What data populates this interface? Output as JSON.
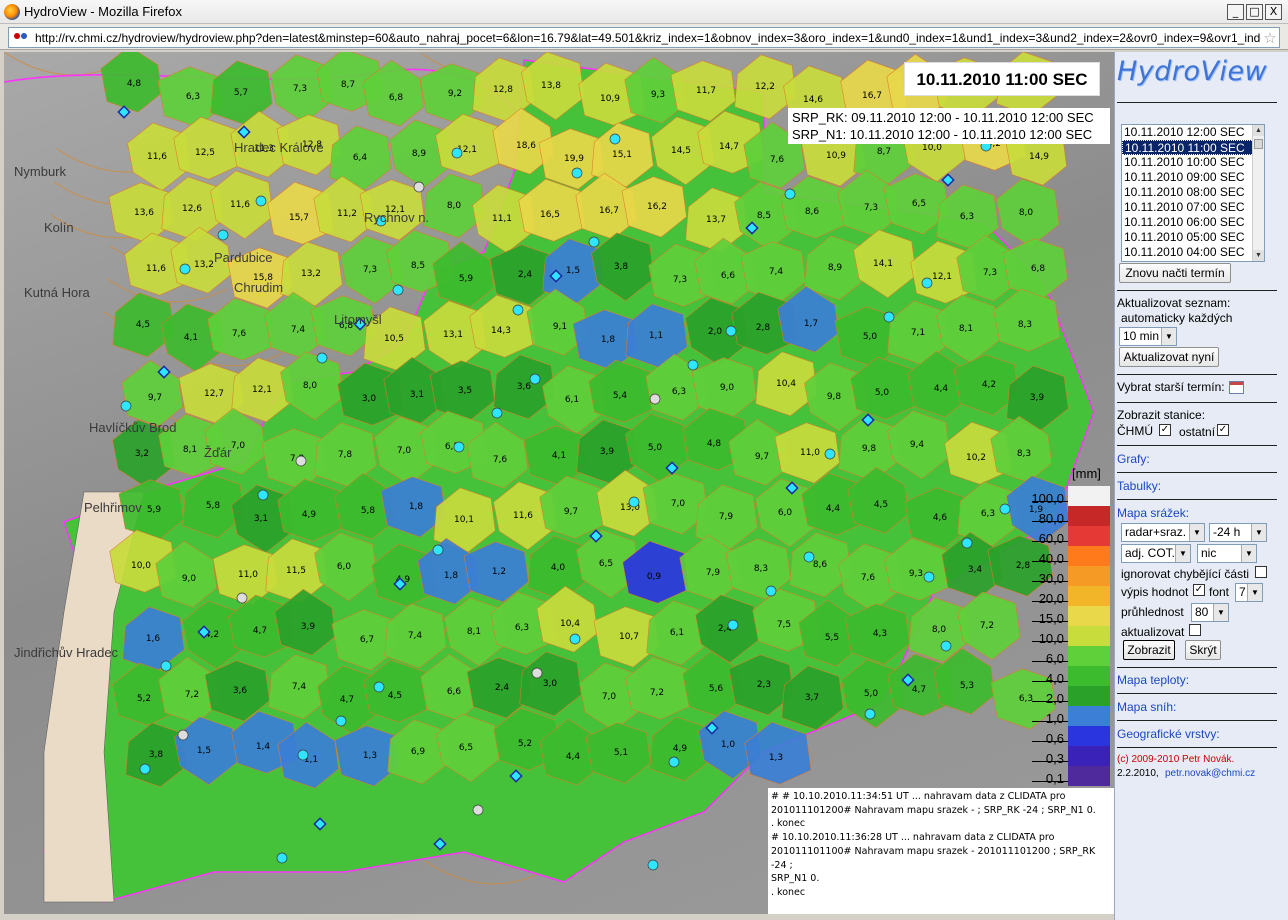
{
  "window": {
    "title": "HydroView - Mozilla Firefox",
    "minimize": "_",
    "maximize": "□",
    "close": "X"
  },
  "address_bar": {
    "url": "http://rv.chmi.cz/hydroview/hydroview.php?den=latest&minstep=60&auto_nahraj_pocet=6&lon=16.79&lat=49.501&kriz_index=1&obnov_index=3&oro_index=1&und0_index=1&und1_index=3&und2_index=2&ovr0_index=9&ovr1_index=12&ovr2_ir"
  },
  "map": {
    "date_label": "10.11.2010 11:00 SEC",
    "srp_lines": [
      "SRP_RK: 09.11.2010 12:00 - 10.11.2010 12:00 SEC",
      "SRP_N1: 10.11.2010 12:00 - 10.11.2010 12:00 SEC"
    ],
    "city_labels": [
      "Hradec Králové",
      "Nymburk",
      "Kolín",
      "Pardubice",
      "Chrudim",
      "Rychnov n.",
      "Kutná Hora",
      "Pelhřimov",
      "Jindřichův Hradec",
      "Litomyšl",
      "Havlíčkův Brod",
      "Žďár"
    ],
    "legend": {
      "unit": "[mm]",
      "levels": [
        {
          "label": "100,0",
          "color": "#f2f2f2"
        },
        {
          "label": "80,0",
          "color": "#c62828"
        },
        {
          "label": "60,0",
          "color": "#e53935"
        },
        {
          "label": "40,0",
          "color": "#ff7a1a"
        },
        {
          "label": "30,0",
          "color": "#f59a25"
        },
        {
          "label": "20,0",
          "color": "#f2b52a"
        },
        {
          "label": "15,0",
          "color": "#e8d84a"
        },
        {
          "label": "10,0",
          "color": "#c8dc3c"
        },
        {
          "label": "6,0",
          "color": "#5fd03a"
        },
        {
          "label": "4,0",
          "color": "#3dbb2e"
        },
        {
          "label": "2,0",
          "color": "#2aa22a"
        },
        {
          "label": "1,0",
          "color": "#3b7fd6"
        },
        {
          "label": "0,6",
          "color": "#2a35e0"
        },
        {
          "label": "0,3",
          "color": "#3a22b8"
        },
        {
          "label": "0,1",
          "color": "#4e2a9c"
        }
      ]
    },
    "log_text": [
      "# # 10.10.2010.11:34:51 UT ... nahravam data z CLIDATA pro",
      "201011101200# Nahravam mapu srazek - ; SRP_RK -24 ; SRP_N1 0.",
      ". konec",
      "# 10.10.2010.11:36:28 UT ... nahravam data z CLIDATA pro",
      "201011101100# Nahravam mapu srazek - 201011101200 ; SRP_RK -24 ;",
      "SRP_N1 0.",
      ". konec"
    ],
    "values": [
      "4,8",
      "6,3",
      "5,7",
      "7,3",
      "8,7",
      "6,8",
      "9,2",
      "12,8",
      "13,8",
      "10,9",
      "9,3",
      "11,7",
      "12,2",
      "14,6",
      "16,7",
      "17,5",
      "13,9",
      "13,1",
      "11,6",
      "12,5",
      "11,3",
      "12,8",
      "6,4",
      "8,9",
      "12,1",
      "18,6",
      "19,9",
      "15,1",
      "14,5",
      "14,7",
      "7,6",
      "10,9",
      "8,7",
      "10,0",
      "15,2",
      "14,9",
      "13,6",
      "12,6",
      "11,6",
      "15,7",
      "11,2",
      "12,1",
      "8,0",
      "11,1",
      "16,5",
      "16,7",
      "16,2",
      "13,7",
      "8,5",
      "8,6",
      "7,3",
      "6,5",
      "6,3",
      "8,0",
      "11,6",
      "13,2",
      "15,8",
      "13,2",
      "7,3",
      "8,5",
      "5,9",
      "2,4",
      "1,5",
      "3,8",
      "7,3",
      "6,6",
      "7,4",
      "8,9",
      "14,1",
      "12,1",
      "7,3",
      "6,8",
      "4,5",
      "4,1",
      "7,6",
      "7,4",
      "6,8",
      "10,5",
      "13,1",
      "14,3",
      "9,1",
      "1,8",
      "1,1",
      "2,0",
      "2,8",
      "1,7",
      "5,0",
      "7,1",
      "8,1",
      "8,3",
      "9,7",
      "12,7",
      "12,1",
      "8,0",
      "3,0",
      "3,1",
      "3,5",
      "3,6",
      "6,1",
      "5,4",
      "6,3",
      "9,0",
      "10,4",
      "9,8",
      "5,0",
      "4,4",
      "4,2",
      "3,9",
      "3,2",
      "8,1",
      "7,0",
      "7,8",
      "7,8",
      "7,0",
      "6,2",
      "7,6",
      "4,1",
      "3,9",
      "5,0",
      "4,8",
      "9,7",
      "11,0",
      "9,8",
      "9,4",
      "10,2",
      "8,3",
      "5,9",
      "5,8",
      "3,1",
      "4,9",
      "5,8",
      "1,8",
      "10,1",
      "11,6",
      "9,7",
      "13,0",
      "7,0",
      "7,9",
      "6,0",
      "4,4",
      "4,5",
      "4,6",
      "6,3",
      "1,9",
      "10,0",
      "9,0",
      "11,0",
      "11,5",
      "6,0",
      "4,9",
      "1,8",
      "1,2",
      "4,0",
      "6,5",
      "0,9",
      "7,9",
      "8,3",
      "8,6",
      "7,6",
      "9,3",
      "3,4",
      "2,8",
      "1,6",
      "4,2",
      "4,7",
      "3,9",
      "6,7",
      "7,4",
      "8,1",
      "6,3",
      "10,4",
      "10,7",
      "6,1",
      "2,4",
      "7,5",
      "5,5",
      "4,3",
      "8,0",
      "7,2",
      "5,2",
      "7,2",
      "3,6",
      "7,4",
      "4,7",
      "4,5",
      "6,6",
      "2,4",
      "3,0",
      "7,0",
      "7,2",
      "5,6",
      "2,3",
      "3,7",
      "5,0",
      "4,7",
      "5,3",
      "6,3",
      "3,8",
      "1,5",
      "1,4",
      "1,1",
      "1,3",
      "6,9",
      "6,5",
      "5,2",
      "4,4",
      "5,1",
      "4,9",
      "1,0",
      "1,3"
    ]
  },
  "sidebar": {
    "logo": "HydroView",
    "time_list": [
      "10.11.2010 12:00 SEC",
      "10.11.2010 11:00 SEC",
      "10.11.2010 10:00 SEC",
      "10.11.2010 09:00 SEC",
      "10.11.2010 08:00 SEC",
      "10.11.2010 07:00 SEC",
      "10.11.2010 06:00 SEC",
      "10.11.2010 05:00 SEC",
      "10.11.2010 04:00 SEC"
    ],
    "selected_time": "10.11.2010 11:00 SEC",
    "reload_button": "Znovu načti termín",
    "update_list_label": "Aktualizovat seznam:",
    "auto_every_label": "automaticky každých",
    "interval_value": "10 min",
    "update_now_button": "Aktualizovat nyní",
    "older_term_label": "Vybrat starší termín:",
    "show_stations_label": "Zobrazit stanice:",
    "chmu_label": "ČHMÚ",
    "others_label": "ostatní",
    "link_graphs": "Grafy:",
    "link_tables": "Tabulky:",
    "precip_map_label": "Mapa srážek:",
    "source_select": "radar+sraz.",
    "period_select": "-24 h",
    "adjust_select": "adj. COT.",
    "extra_select": "nic",
    "ignore_missing_label": "ignorovat chybějící části",
    "show_values_label": "výpis hodnot",
    "font_label": "font",
    "font_select": "7",
    "opacity_label": "průhlednost",
    "opacity_select": "80",
    "update_label": "aktualizovat",
    "show_button": "Zobrazit",
    "hide_button": "Skrýt",
    "link_temp_map": "Mapa teploty:",
    "link_snow_map": "Mapa sníh:",
    "link_geo_layers": "Geografické vrstvy:",
    "copyright": "(c) 2009-2010 Petr Novák.",
    "date": "2.2.2010,",
    "email": "petr.novak@chmi.cz"
  }
}
